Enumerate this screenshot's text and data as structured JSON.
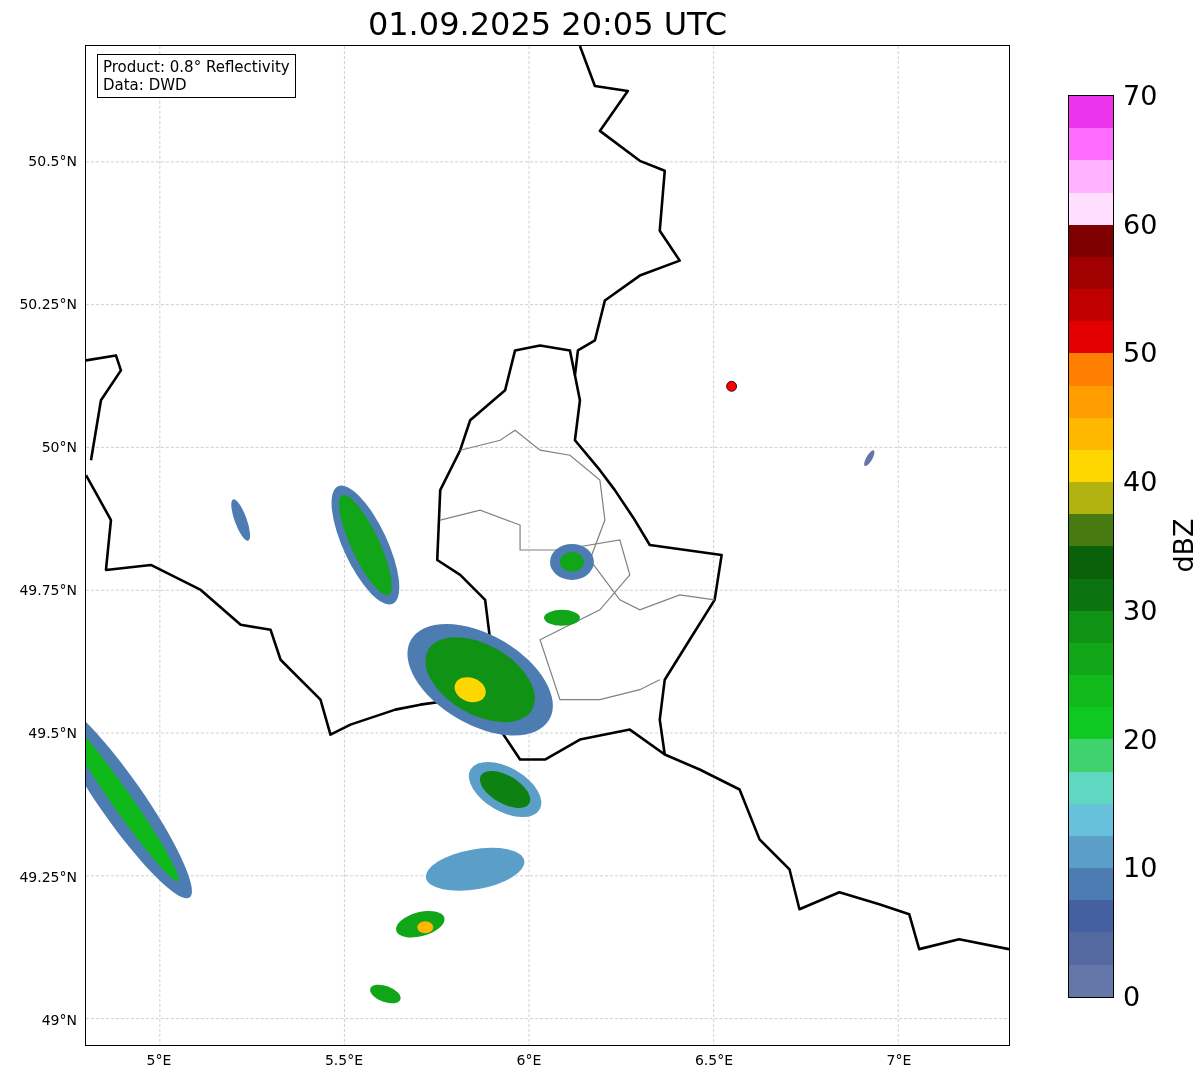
{
  "title": "01.09.2025 20:05 UTC",
  "map": {
    "legend": [
      "Product: 0.8° Reflectivity",
      "Data: DWD"
    ],
    "yticks": [
      "50.5°N",
      "50.25°N",
      "50°N",
      "49.75°N",
      "49.5°N",
      "49.25°N",
      "49°N"
    ],
    "xticks": [
      "5°E",
      "5.5°E",
      "6°E",
      "6.5°E",
      "7°E"
    ]
  },
  "colorbar": {
    "label": "dBZ",
    "ticks": [
      "70",
      "60",
      "50",
      "40",
      "30",
      "20",
      "10",
      "0"
    ],
    "bins": [
      {
        "color": "#6577a8"
      },
      {
        "color": "#5569a1"
      },
      {
        "color": "#4460a1"
      },
      {
        "color": "#4c7cb2"
      },
      {
        "color": "#5b9fc9"
      },
      {
        "color": "#68c1da"
      },
      {
        "color": "#5fd8c2"
      },
      {
        "color": "#3fd26e"
      },
      {
        "color": "#10c822"
      },
      {
        "color": "#11b91a"
      },
      {
        "color": "#10a617"
      },
      {
        "color": "#109314"
      },
      {
        "color": "#0b730f"
      },
      {
        "color": "#0b6109"
      },
      {
        "color": "#477a10"
      },
      {
        "color": "#b1b110"
      },
      {
        "color": "#ffd700"
      },
      {
        "color": "#ffb700"
      },
      {
        "color": "#ff9c00"
      },
      {
        "color": "#ff7f00"
      },
      {
        "color": "#e40000"
      },
      {
        "color": "#c00000"
      },
      {
        "color": "#a00000"
      },
      {
        "color": "#7f0000"
      },
      {
        "color": "#ffdeff"
      },
      {
        "color": "#ffb2ff"
      },
      {
        "color": "#ff6bff"
      },
      {
        "color": "#ec34ec"
      }
    ]
  }
}
